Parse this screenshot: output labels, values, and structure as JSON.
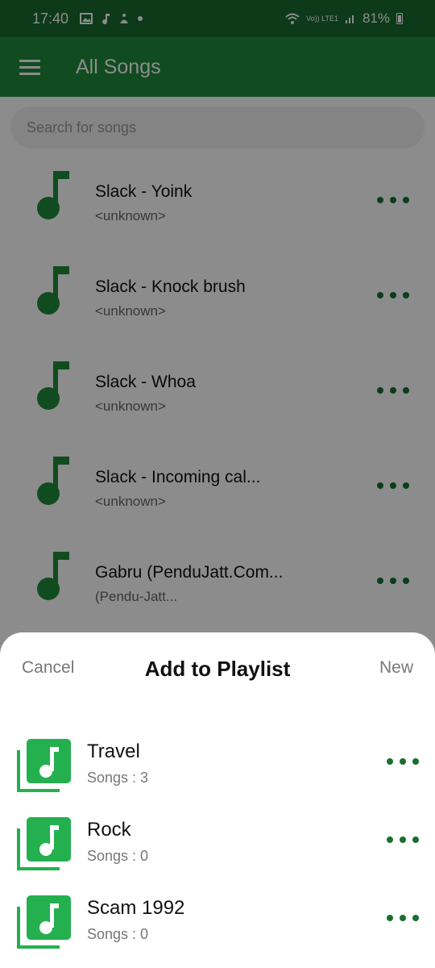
{
  "status_bar": {
    "time": "17:40",
    "battery": "81%",
    "net": "Vo)) LTE1"
  },
  "app_bar": {
    "title": "All Songs"
  },
  "search": {
    "placeholder": "Search for songs"
  },
  "songs": [
    {
      "title": "Slack - Yoink",
      "artist": "<unknown>"
    },
    {
      "title": "Slack - Knock brush",
      "artist": "<unknown>"
    },
    {
      "title": "Slack - Whoa",
      "artist": "<unknown>"
    },
    {
      "title": "Slack - Incoming cal...",
      "artist": "<unknown>"
    },
    {
      "title": "Gabru (PenduJatt.Com...",
      "artist": " (Pendu-Jatt..."
    }
  ],
  "sheet": {
    "cancel_label": "Cancel",
    "title": "Add to Playlist",
    "new_label": "New",
    "playlists": [
      {
        "name": "Travel",
        "count": "Songs : 3"
      },
      {
        "name": "Rock",
        "count": "Songs : 0"
      },
      {
        "name": "Scam 1992",
        "count": "Songs : 0"
      }
    ]
  },
  "colors": {
    "primary": "#1e8a3a",
    "status": "#186b2e",
    "accent": "#25b04f"
  },
  "icons": [
    "menu-icon",
    "music-note-icon",
    "more-icon",
    "playlist-icon",
    "wifi-icon",
    "signal-icon",
    "battery-icon"
  ]
}
